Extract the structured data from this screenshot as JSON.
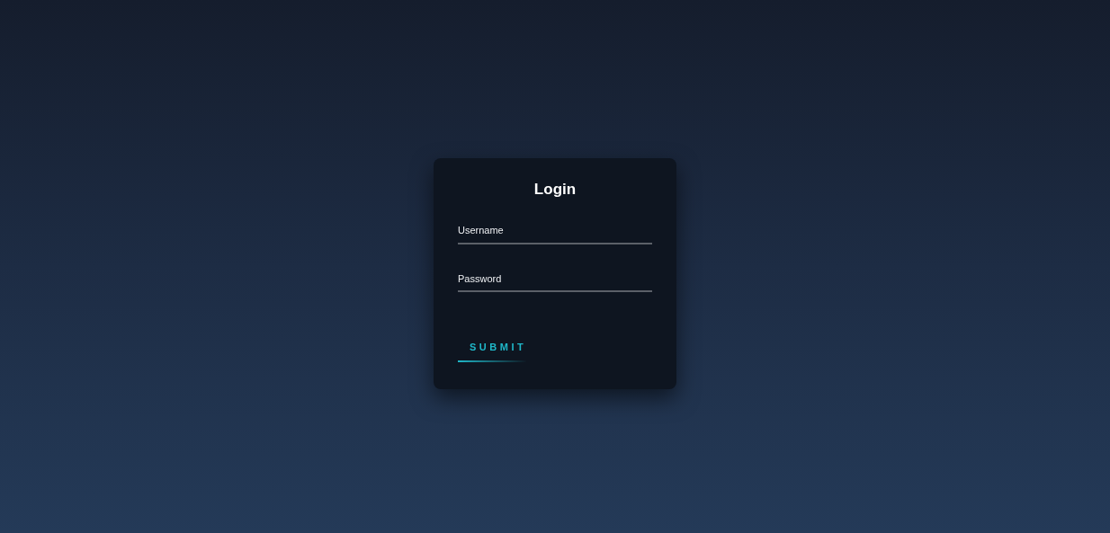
{
  "title": "Login",
  "fields": [
    {
      "placeholder": "Username"
    },
    {
      "placeholder": "Password"
    }
  ],
  "submit": {
    "label": "SUBMIT"
  }
}
